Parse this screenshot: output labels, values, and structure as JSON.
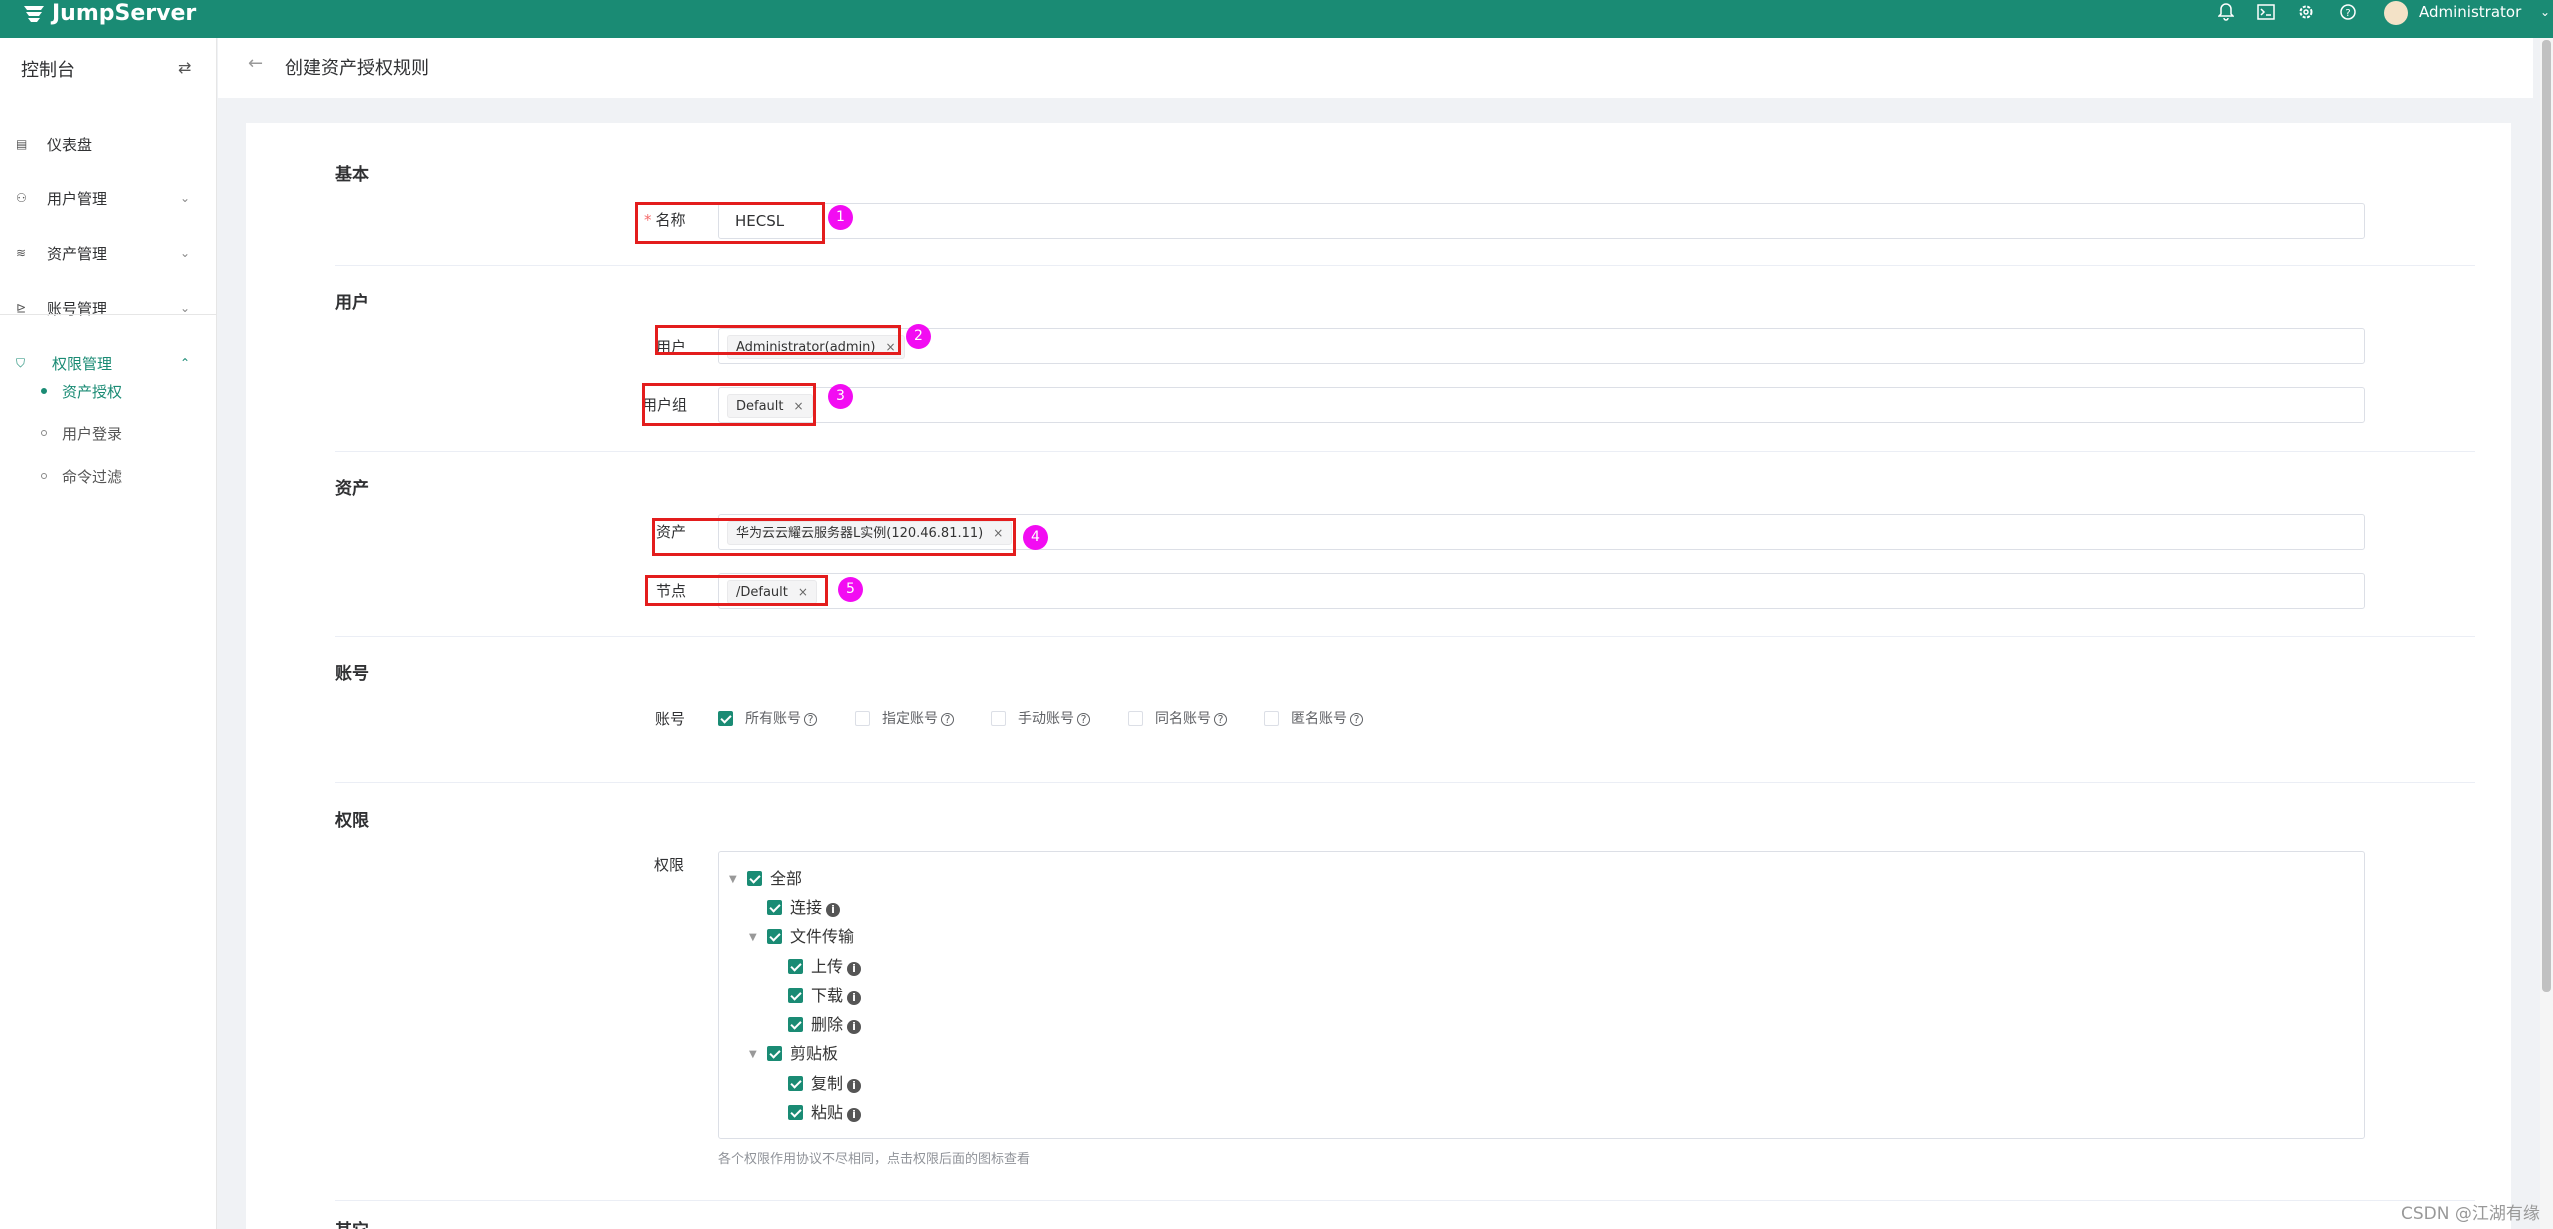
{
  "app": {
    "logo_text": "JumpServer",
    "accent": "#1a8b74"
  },
  "header": {
    "user_name": "Administrator",
    "icons": [
      "bell-icon",
      "terminal-icon",
      "gear-icon",
      "help-icon"
    ]
  },
  "sidebar": {
    "title": "控制台",
    "items": [
      {
        "label": "仪表盘",
        "icon": "dashboard-icon"
      },
      {
        "label": "用户管理",
        "icon": "users-icon"
      },
      {
        "label": "资产管理",
        "icon": "assets-icon"
      },
      {
        "label": "账号管理",
        "icon": "accounts-icon"
      },
      {
        "label": "权限管理",
        "icon": "shield-icon",
        "expanded": true
      }
    ],
    "sub_items": [
      {
        "label": "资产授权",
        "active": true
      },
      {
        "label": "用户登录",
        "active": false
      },
      {
        "label": "命令过滤",
        "active": false
      }
    ]
  },
  "page": {
    "title": "创建资产授权规则"
  },
  "form": {
    "sections": {
      "basic": "基本",
      "user": "用户",
      "asset": "资产",
      "account": "账号",
      "perm": "权限",
      "other": "其它"
    },
    "name": {
      "label": "名称",
      "value": "HECSL"
    },
    "users": {
      "label": "用户",
      "tags": [
        "Administrator(admin)"
      ]
    },
    "user_groups": {
      "label": "用户组",
      "tags": [
        "Default"
      ]
    },
    "assets": {
      "label": "资产",
      "tags": [
        "华为云云耀云服务器L实例(120.46.81.11)"
      ]
    },
    "nodes": {
      "label": "节点",
      "tags": [
        "/Default"
      ]
    },
    "accounts": {
      "label": "账号",
      "options": [
        {
          "label": "所有账号",
          "checked": true
        },
        {
          "label": "指定账号",
          "checked": false
        },
        {
          "label": "手动账号",
          "checked": false
        },
        {
          "label": "同名账号",
          "checked": false
        },
        {
          "label": "匿名账号",
          "checked": false
        }
      ]
    },
    "permissions": {
      "label": "权限",
      "tree": [
        {
          "label": "全部"
        },
        {
          "label": "连接"
        },
        {
          "label": "文件传输"
        },
        {
          "label": "上传"
        },
        {
          "label": "下载"
        },
        {
          "label": "删除"
        },
        {
          "label": "剪贴板"
        },
        {
          "label": "复制"
        },
        {
          "label": "粘贴"
        }
      ],
      "hint": "各个权限作用协议不尽相同，点击权限后面的图标查看"
    },
    "annotations": [
      "1",
      "2",
      "3",
      "4",
      "5"
    ]
  },
  "watermark": "CSDN @江湖有缘"
}
